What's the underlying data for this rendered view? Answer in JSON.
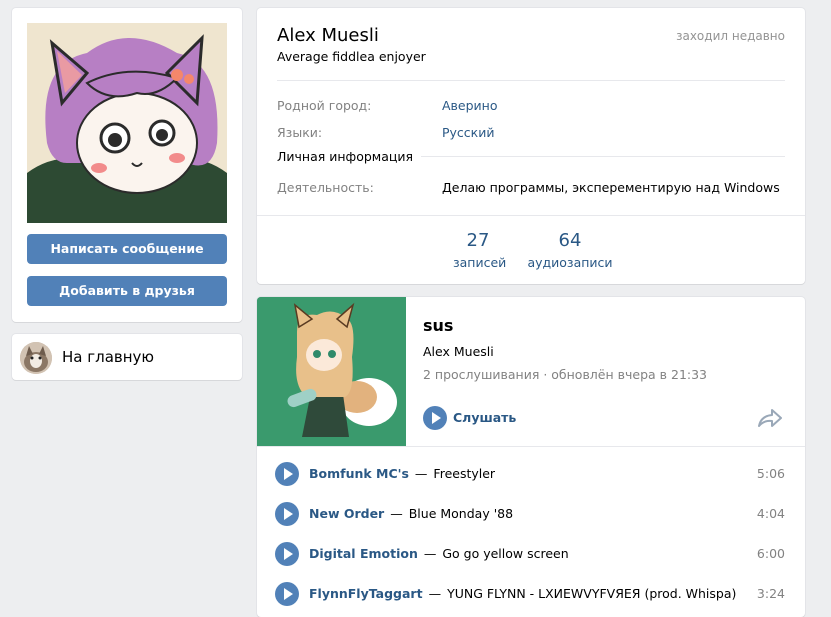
{
  "left": {
    "message_button": "Написать сообщение",
    "add_friend_button": "Добавить в друзья",
    "home_link": "На главную"
  },
  "profile": {
    "name": "Alex Muesli",
    "status": "Average fiddlea enjoyer",
    "online": "заходил недавно",
    "fields": {
      "hometown_label": "Родной город:",
      "hometown_value": "Аверино",
      "languages_label": "Языки:",
      "languages_value": "Русский",
      "section_title": "Личная информация",
      "activity_label": "Деятельность:",
      "activity_value": "Делаю программы, эксперементирую над Windows"
    },
    "counters": [
      {
        "num": "27",
        "caption": "записей"
      },
      {
        "num": "64",
        "caption": "аудиозаписи"
      }
    ]
  },
  "playlist": {
    "title": "sus",
    "owner": "Alex Muesli",
    "meta": "2 прослушивания · обновлён вчера в 21:33",
    "play_label": "Слушать",
    "tracks": [
      {
        "artist": "Bomfunk MC's",
        "title": "Freestyler",
        "duration": "5:06"
      },
      {
        "artist": "New Order",
        "title": "Blue Monday '88",
        "duration": "4:04"
      },
      {
        "artist": "Digital Emotion",
        "title": "Go go yellow screen",
        "duration": "6:00"
      },
      {
        "artist": "FlynnFlyTaggart",
        "title": "YUNG FLYNN - LXИEWVYFVЯEЯ (prod. Whispa)",
        "duration": "3:24"
      }
    ]
  },
  "colors": {
    "accent": "#5181b8",
    "link": "#2a5885",
    "page_bg": "#edeef0",
    "cover_bg": "#3a9a6d"
  },
  "icons": {
    "play": "play-icon",
    "share": "share-icon"
  }
}
